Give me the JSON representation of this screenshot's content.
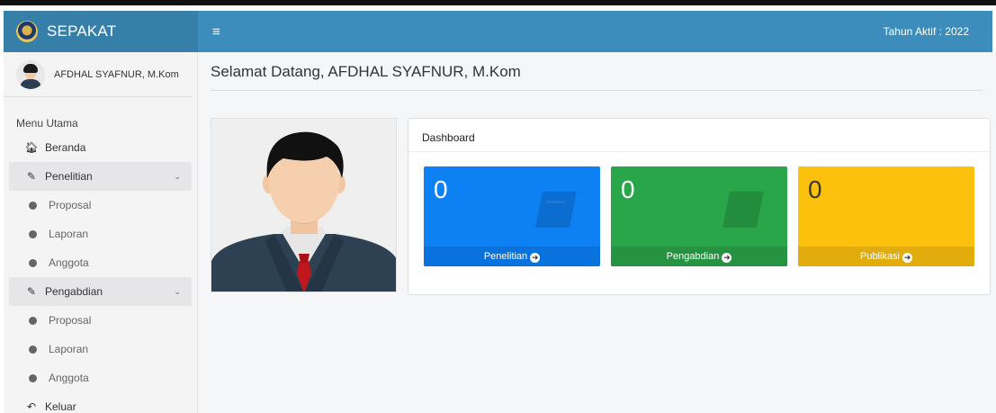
{
  "app": {
    "brand": "SEPAKAT",
    "active_year": "Tahun Aktif : 2022"
  },
  "user": {
    "name": "AFDHAL SYAFNUR, M.Kom"
  },
  "sidebar": {
    "header": "Menu Utama",
    "items": {
      "beranda": "Beranda",
      "penelitian": "Penelitian",
      "penelitian_proposal": "Proposal",
      "penelitian_laporan": "Laporan",
      "penelitian_anggota": "Anggota",
      "pengabdian": "Pengabdian",
      "pengabdian_proposal": "Proposal",
      "pengabdian_laporan": "Laporan",
      "pengabdian_anggota": "Anggota",
      "keluar": "Keluar"
    }
  },
  "main": {
    "welcome": "Selamat Datang, AFDHAL SYAFNUR, M.Kom",
    "dashboard_title": "Dashboard",
    "boxes": [
      {
        "value": "0",
        "label": "Penelitian",
        "color": "#0d80f4"
      },
      {
        "value": "0",
        "label": "Pengabdian",
        "color": "#2aa64a"
      },
      {
        "value": "0",
        "label": "Publikasi",
        "color": "#fcc10d"
      }
    ]
  },
  "colors": {
    "header_brand": "#367fa9",
    "header_bar": "#3c8dbc"
  }
}
